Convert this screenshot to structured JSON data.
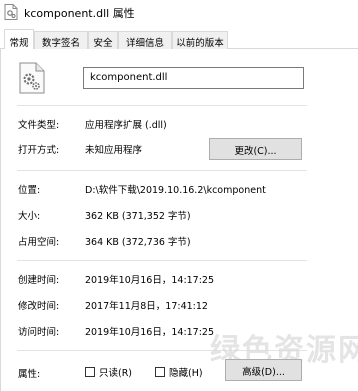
{
  "window": {
    "title": "kcomponent.dll 属性"
  },
  "tabs": [
    {
      "label": "常规"
    },
    {
      "label": "数字签名"
    },
    {
      "label": "安全"
    },
    {
      "label": "详细信息"
    },
    {
      "label": "以前的版本"
    }
  ],
  "file": {
    "name": "kcomponent.dll"
  },
  "rows": {
    "type": {
      "label": "文件类型:",
      "value": "应用程序扩展 (.dll)"
    },
    "opens_with": {
      "label": "打开方式:",
      "value": "未知应用程序",
      "button": "更改(C)..."
    },
    "location": {
      "label": "位置:",
      "value": "D:\\软件下载\\2019.10.16.2\\kcomponent"
    },
    "size": {
      "label": "大小:",
      "value": "362 KB (371,352 字节)"
    },
    "size_on_disk": {
      "label": "占用空间:",
      "value": "364 KB (372,736 字节)"
    },
    "created": {
      "label": "创建时间:",
      "value": "2019年10月16日，14:17:25"
    },
    "modified": {
      "label": "修改时间:",
      "value": "2017年11月8日，17:41:12"
    },
    "accessed": {
      "label": "访问时间:",
      "value": "2019年10月16日，14:17:25"
    },
    "attributes": {
      "label": "属性:",
      "readonly": "只读(R)",
      "hidden": "隐藏(H)",
      "advanced_button": "高级(D)..."
    }
  },
  "watermark": "绿色资源网"
}
